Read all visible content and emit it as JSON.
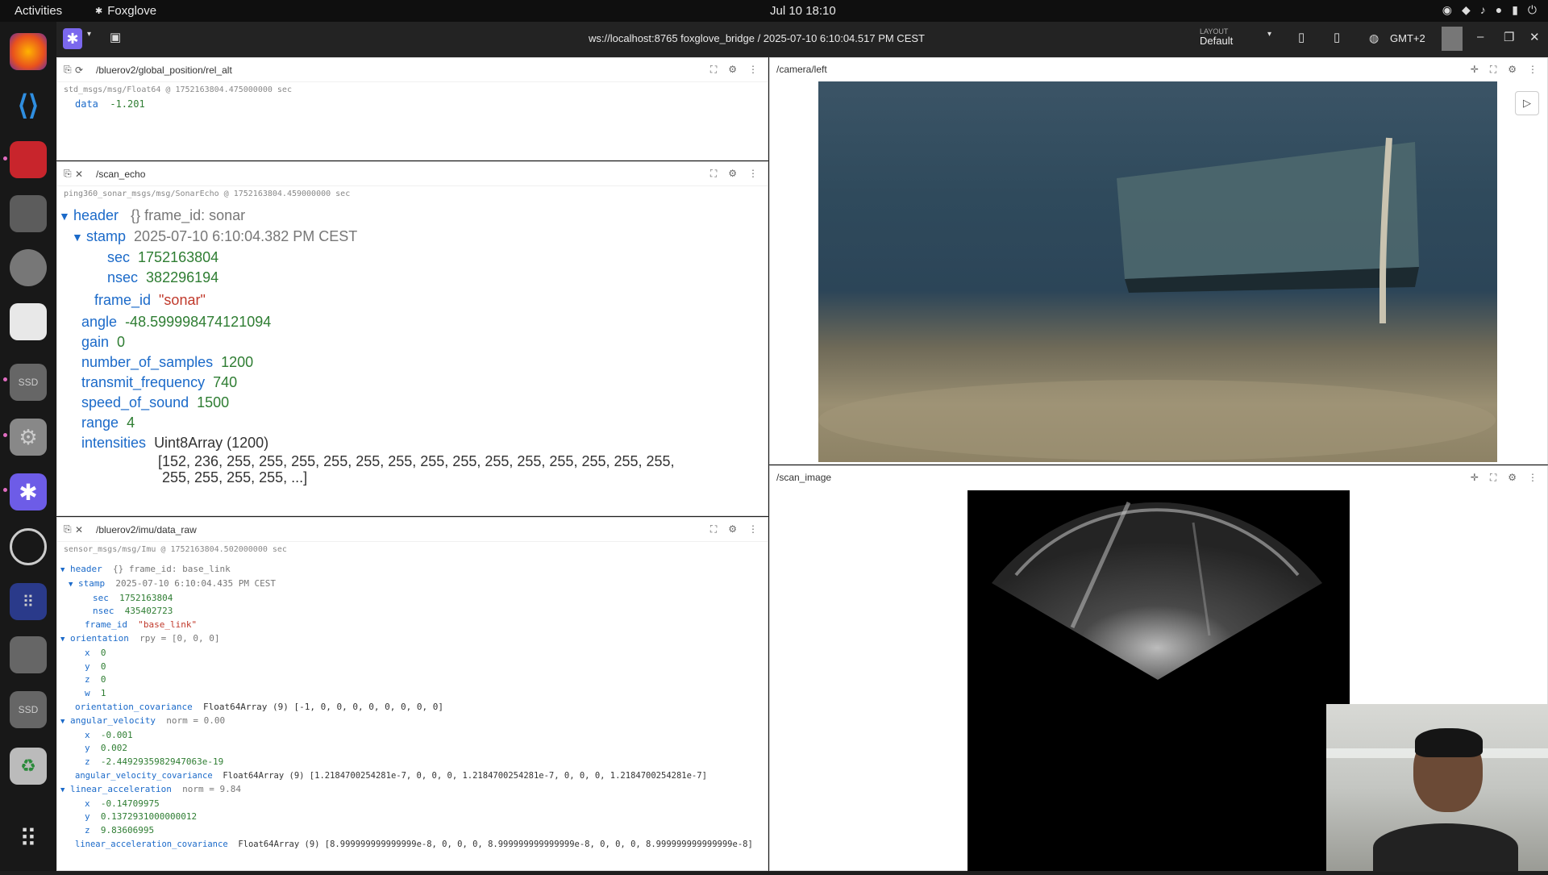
{
  "topbar": {
    "activities": "Activities",
    "app": "Foxglove",
    "clock": "Jul 10  18:10"
  },
  "dock": {
    "items": [
      "firefox-icon",
      "vscode-icon",
      "terminal-icon",
      "files-icon",
      "settings-icon",
      "text-editor-icon",
      "ssd-drive-icon",
      "gear-icon",
      "foxglove-icon",
      "obs-icon",
      "app-grid-icon",
      "disk-icon",
      "ssd-drive-icon",
      "trash-icon",
      "show-apps-icon"
    ],
    "ssd_label": "SSD"
  },
  "fgbar": {
    "connection": "ws://localhost:8765 foxglove_bridge / 2025-07-10 6:10:04.517 PM CEST",
    "layout_label": "LAYOUT",
    "layout_value": "Default",
    "timezone": "GMT+2"
  },
  "panel_rel_alt": {
    "topic": "/bluerov2/global_position/rel_alt",
    "meta": "std_msgs/msg/Float64 @ 1752163804.475000000 sec",
    "key": "data",
    "value": "-1.201"
  },
  "panel_scan_echo": {
    "topic": "/scan_echo",
    "meta": "ping360_sonar_msgs/msg/SonarEcho @ 1752163804.459000000 sec",
    "header_k": "header",
    "header_v": "{} frame_id: sonar",
    "stamp_k": "stamp",
    "stamp_v": "2025-07-10 6:10:04.382 PM CEST",
    "sec_k": "sec",
    "sec_v": "1752163804",
    "nsec_k": "nsec",
    "nsec_v": "382296194",
    "frame_k": "frame_id",
    "frame_v": "\"sonar\"",
    "angle_k": "angle",
    "angle_v": "-48.599998474121094",
    "gain_k": "gain",
    "gain_v": "0",
    "nos_k": "number_of_samples",
    "nos_v": "1200",
    "tf_k": "transmit_frequency",
    "tf_v": "740",
    "sos_k": "speed_of_sound",
    "sos_v": "1500",
    "range_k": "range",
    "range_v": "4",
    "int_k": "intensities",
    "int_v": "Uint8Array (1200)",
    "int_line1": "[152, 236, 255, 255, 255, 255, 255, 255, 255, 255, 255, 255, 255, 255, 255, 255,",
    "int_line2": "255, 255, 255, 255, ...]"
  },
  "panel_imu": {
    "topic": "/bluerov2/imu/data_raw",
    "meta": "sensor_msgs/msg/Imu @ 1752163804.502000000 sec",
    "header_k": "header",
    "header_v": "{} frame_id: base_link",
    "stamp_k": "stamp",
    "stamp_v": "2025-07-10 6:10:04.435 PM CEST",
    "sec_k": "sec",
    "sec_v": "1752163804",
    "nsec_k": "nsec",
    "nsec_v": "435402723",
    "frame_k": "frame_id",
    "frame_v": "\"base_link\"",
    "ori_k": "orientation",
    "ori_v": "rpy = [0, 0, 0]",
    "ox": "0",
    "oy": "0",
    "oz": "0",
    "ow": "1",
    "oc_k": "orientation_covariance",
    "oc_v": "Float64Array (9) [-1, 0, 0, 0, 0, 0, 0, 0, 0]",
    "av_k": "angular_velocity",
    "av_v": "norm = 0.00",
    "avx": "-0.001",
    "avy": "0.002",
    "avz": "-2.4492935982947063e-19",
    "avc_k": "angular_velocity_covariance",
    "avc_v": "Float64Array (9) [1.2184700254281e-7, 0, 0, 0, 1.2184700254281e-7, 0, 0, 0, 1.2184700254281e-7]",
    "la_k": "linear_acceleration",
    "la_v": "norm = 9.84",
    "lax": "-0.14709975",
    "lay": "0.1372931000000012",
    "laz": "9.83606995",
    "lac_k": "linear_acceleration_covariance",
    "lac_v": "Float64Array (9) [8.999999999999999e-8, 0, 0, 0, 8.999999999999999e-8, 0, 0, 0, 8.999999999999999e-8]"
  },
  "panel_camera": {
    "topic": "/camera/left"
  },
  "panel_scan_image": {
    "topic": "/scan_image"
  },
  "keys": {
    "x": "x",
    "y": "y",
    "z": "z",
    "w": "w",
    "sec": "sec",
    "nsec": "nsec"
  }
}
